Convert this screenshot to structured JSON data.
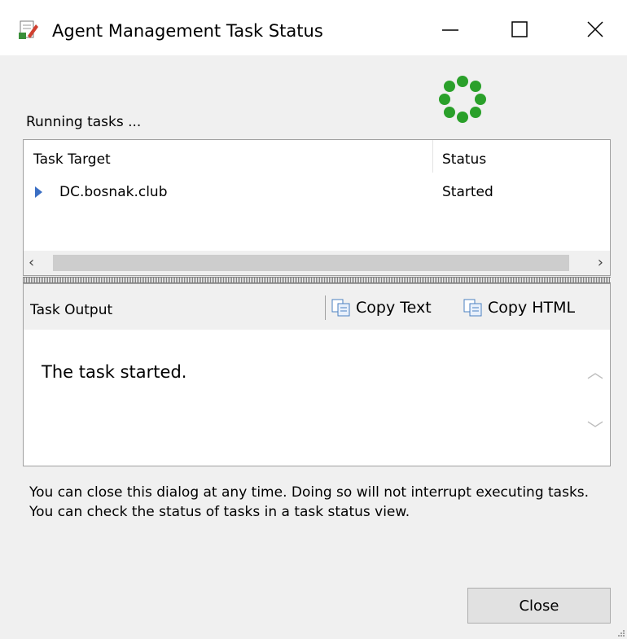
{
  "window": {
    "title": "Agent Management Task Status"
  },
  "status": {
    "running_label": "Running tasks ..."
  },
  "task_grid": {
    "columns": [
      "Task Target",
      "Status"
    ],
    "rows": [
      {
        "target": "DC.bosnak.club",
        "status": "Started"
      }
    ]
  },
  "output": {
    "title": "Task Output",
    "copy_text_label": "Copy Text",
    "copy_html_label": "Copy HTML",
    "message": "The task started."
  },
  "info_text": "You can close this dialog at any time. Doing so will not interrupt executing tasks. You can check the status of tasks in a task status view.",
  "buttons": {
    "close_label": "Close"
  },
  "icons": {
    "title": "task-status-icon",
    "spinner": "progress-spinner-icon",
    "copy": "copy-icon",
    "row_expand": "expand-arrow-icon"
  },
  "colors": {
    "spinner_green": "#2aa02a",
    "arrow_blue": "#3b6fc4"
  }
}
